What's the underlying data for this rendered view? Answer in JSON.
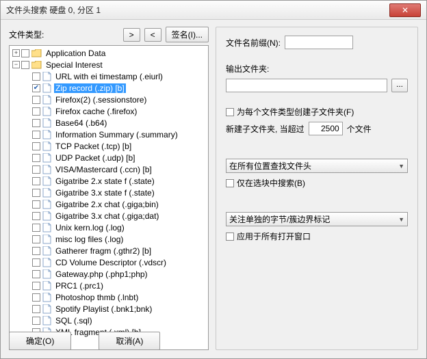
{
  "window": {
    "title": "文件头搜索 硬盘 0, 分区 1"
  },
  "left": {
    "file_type_label": "文件类型:",
    "prev": ">",
    "next": "<",
    "sign": "签名(I)...",
    "tree": {
      "app_data": {
        "label": "Application Data",
        "expand": "+"
      },
      "special": {
        "label": "Special Interest",
        "expand": "−"
      },
      "items": [
        {
          "label": "URL with ei timestamp (.eiurl)",
          "checked": false
        },
        {
          "label": "Zip record (.zip) [b]",
          "checked": true,
          "selected": true
        },
        {
          "label": "Firefox(2) (.sessionstore)",
          "checked": false
        },
        {
          "label": "Firefox cache (.firefox)",
          "checked": false
        },
        {
          "label": "Base64 (.b64)",
          "checked": false
        },
        {
          "label": "Information Summary (.summary)",
          "checked": false
        },
        {
          "label": "TCP Packet (.tcp) [b]",
          "checked": false
        },
        {
          "label": "UDP Packet (.udp) [b]",
          "checked": false
        },
        {
          "label": "VISA/Mastercard (.ccn) [b]",
          "checked": false
        },
        {
          "label": "Gigatribe 2.x state f (.state)",
          "checked": false
        },
        {
          "label": "Gigatribe 3.x state f (.state)",
          "checked": false
        },
        {
          "label": "Gigatribe 2.x chat (.giga;bin)",
          "checked": false
        },
        {
          "label": "Gigatribe 3.x chat (.giga;dat)",
          "checked": false
        },
        {
          "label": "Unix kern.log (.log)",
          "checked": false
        },
        {
          "label": "misc log files (.log)",
          "checked": false
        },
        {
          "label": "Gatherer fragm (.gthr2) [b]",
          "checked": false
        },
        {
          "label": "CD Volume Descriptor (.vdscr)",
          "checked": false
        },
        {
          "label": "Gateway.php (.php1;php)",
          "checked": false
        },
        {
          "label": "PRC1 (.prc1)",
          "checked": false
        },
        {
          "label": "Photoshop thmb (.lnbt)",
          "checked": false
        },
        {
          "label": "Spotify Playlist (.bnk1;bnk)",
          "checked": false
        },
        {
          "label": "SQL (.sql)",
          "checked": false
        },
        {
          "label": "XML fragment (.xml) [b]",
          "checked": false
        }
      ]
    }
  },
  "right": {
    "prefix_label": "文件名前缀(N):",
    "prefix_value": "",
    "output_label": "输出文件夹:",
    "output_value": "",
    "browse": "...",
    "subfolder_chk": "为每个文件类型创建子文件夹(F)",
    "subfolder_line_a": "新建子文件夹, 当超过",
    "subfolder_value": "2500",
    "subfolder_line_b": "个文件",
    "search_select": "在所有位置查找文件头",
    "only_sel_chk": "仅在选块中搜索(B)",
    "byte_select": "关注单独的字节/簇边界标记",
    "apply_chk": "应用于所有打开窗口"
  },
  "footer": {
    "ok": "确定(O)",
    "cancel": "取消(A)"
  }
}
